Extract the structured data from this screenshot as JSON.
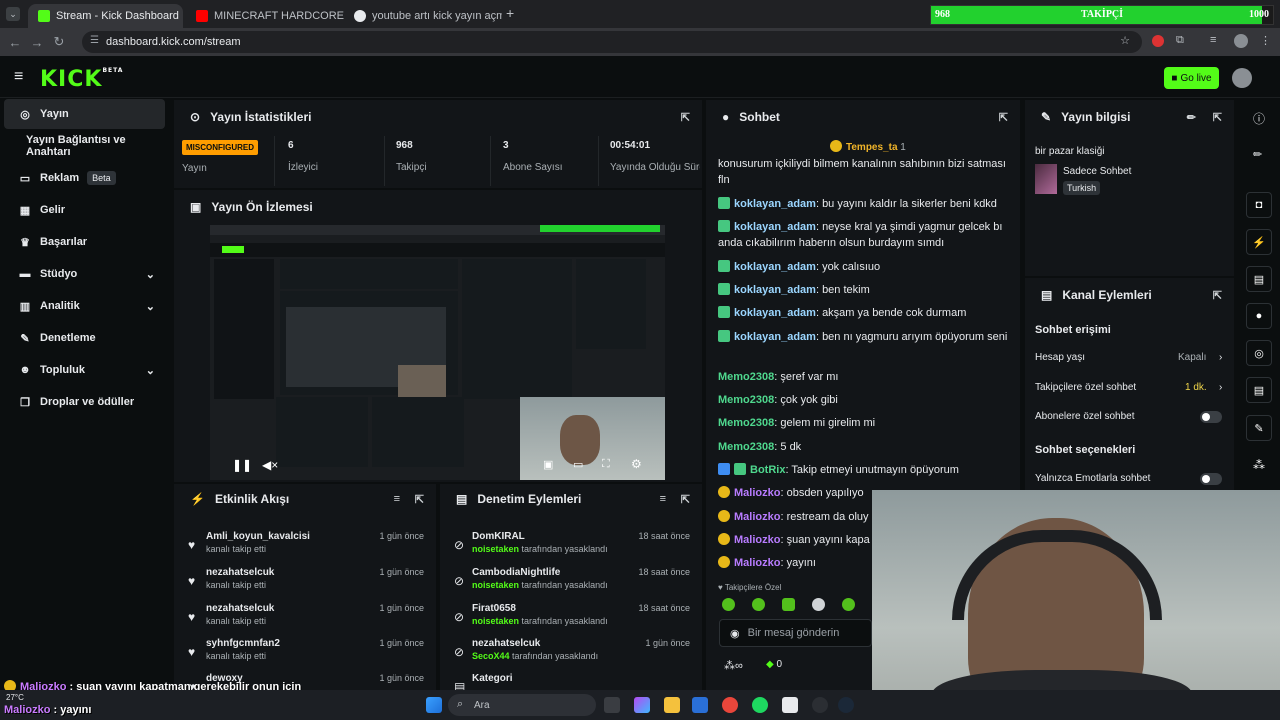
{
  "browser": {
    "tabs": [
      {
        "title": "Stream - Kick Dashboard",
        "active": true
      },
      {
        "title": "MINECRAFT HARDCORE ALL B"
      },
      {
        "title": "youtube artı kick yayın açma - "
      }
    ],
    "new_tab": "+",
    "url": "dashboard.kick.com/stream"
  },
  "follower_overlay": {
    "current": "968",
    "label": "TAKİPÇİ",
    "goal": "1000",
    "progress": 0.968
  },
  "header": {
    "logo": "KICK",
    "logo_badge": "BETA",
    "go_live": "Go live"
  },
  "sidebar": {
    "items": [
      {
        "label": "Yayın",
        "icon": "broadcast-icon"
      },
      {
        "label": "Yayın Bağlantısı ve Anahtarı"
      },
      {
        "label": "Reklam",
        "badge": "Beta"
      },
      {
        "label": "Gelir"
      },
      {
        "label": "Başarılar"
      },
      {
        "label": "Stüdyo"
      },
      {
        "label": "Analitik"
      },
      {
        "label": "Denetleme"
      },
      {
        "label": "Topluluk"
      },
      {
        "label": "Droplar ve ödüller"
      }
    ]
  },
  "stats": {
    "title": "Yayın İstatistikleri",
    "status": "MISCONFIGURED",
    "status_label": "Yayın",
    "viewers": {
      "value": "6",
      "label": "İzleyici"
    },
    "followers": {
      "value": "968",
      "label": "Takipçi"
    },
    "subs": {
      "value": "3",
      "label": "Abone Sayısı"
    },
    "uptime": {
      "value": "00:54:01",
      "label": "Yayında Olduğu Süre"
    }
  },
  "preview": {
    "title": "Yayın Ön İzlemesi"
  },
  "activity": {
    "title": "Etkinlik Akışı",
    "rows": [
      {
        "name": "Amli_koyun_kavalcisi",
        "sub": "kanalı takip etti",
        "time": "1 gün önce"
      },
      {
        "name": "nezahatselcuk",
        "sub": "kanalı takip etti",
        "time": "1 gün önce"
      },
      {
        "name": "nezahatselcuk",
        "sub": "kanalı takip etti",
        "time": "1 gün önce"
      },
      {
        "name": "syhnfgcmnfan2",
        "sub": "kanalı takip etti",
        "time": "1 gün önce"
      },
      {
        "name": "dewoxy",
        "sub": "",
        "time": "1 gün önce"
      }
    ]
  },
  "moderation": {
    "title": "Denetim Eylemleri",
    "rows": [
      {
        "name": "DomKIRAL",
        "mod": "noisetaken",
        "action": "tarafından yasaklandı",
        "time": "18 saat önce"
      },
      {
        "name": "CambodiaNightlife",
        "mod": "noisetaken",
        "action": "tarafından yasaklandı",
        "time": "18 saat önce"
      },
      {
        "name": "Firat0658",
        "mod": "noisetaken",
        "action": "tarafından yasaklandı",
        "time": "18 saat önce"
      },
      {
        "name": "nezahatselcuk",
        "mod": "SecoX44",
        "action": "tarafından yasaklandı",
        "time": "1 gün önce"
      },
      {
        "name": "Kategori",
        "mod": "",
        "action": "",
        "time": ""
      }
    ]
  },
  "chat": {
    "title": "Sohbet",
    "pinned_user": "Tempes_ta",
    "pinned_count": "1",
    "messages": [
      {
        "user": "",
        "text": "konusurum içkiliydi bilmem kanalının sahıbının bizi satması fln"
      },
      {
        "user": "koklayan_adam",
        "text": "bu yayını kaldır la sikerler beni kdkd"
      },
      {
        "user": "koklayan_adam",
        "text": "neyse kral ya şimdi yagmur gelcek bı anda cıkabilırım haberın olsun burdayım sımdı"
      },
      {
        "user": "koklayan_adam",
        "text": "yok calısıuo"
      },
      {
        "user": "koklayan_adam",
        "text": "ben tekim"
      },
      {
        "user": "koklayan_adam",
        "text": "akşam ya bende cok durmam"
      },
      {
        "user": "koklayan_adam",
        "text": "ben nı yagmuru arıyım öpüyorum seni"
      },
      {
        "user": "Memo2308",
        "text": "şeref var mı"
      },
      {
        "user": "Memo2308",
        "text": "çok yok gibi"
      },
      {
        "user": "Memo2308",
        "text": "gelem mi girelim mi"
      },
      {
        "user": "Memo2308",
        "text": "5 dk"
      },
      {
        "user": "BotRix",
        "text": "Takip etmeyi unutmayın öpüyorum"
      },
      {
        "user": "Maliozko",
        "text": "obsden yapılıyo"
      },
      {
        "user": "Maliozko",
        "text": "restream da oluy"
      },
      {
        "user": "Maliozko",
        "text": "şuan yayını kapa"
      },
      {
        "user": "Maliozko",
        "text": "yayını"
      }
    ],
    "followers_only": "Takipçilere Özel",
    "input_placeholder": "Bir mesaj gönderin",
    "footer_count": "0"
  },
  "stream_info": {
    "title": "Yayın bilgisi",
    "stream_title": "bir pazar klasiği",
    "category": "Sadece Sohbet",
    "language": "Turkish"
  },
  "channel_actions": {
    "title": "Kanal Eylemleri",
    "access_heading": "Sohbet erişimi",
    "account_age": {
      "label": "Hesap yaşı",
      "value": "Kapalı"
    },
    "followers_chat": {
      "label": "Takipçilere özel sohbet",
      "value": "1 dk."
    },
    "subs_chat": {
      "label": "Abonelere özel sohbet"
    },
    "options_heading": "Sohbet seçenekleri",
    "emotes_only": {
      "label": "Yalnızca Emotlarla sohbet"
    }
  },
  "overlay_chat": [
    {
      "user": "Maliozko",
      "text": "şuan yayını kapatman gerekebilir onun için"
    },
    {
      "user": "Maliozko",
      "text": "yayını"
    }
  ],
  "taskbar": {
    "search_placeholder": "Ara",
    "weather": "27°C"
  }
}
